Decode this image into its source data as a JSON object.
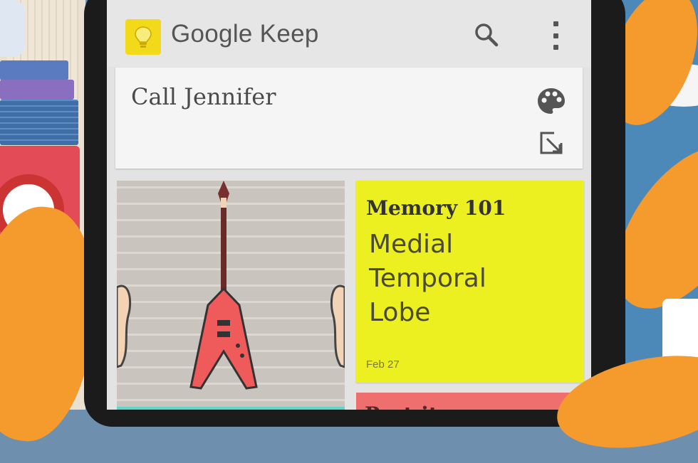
{
  "app": {
    "title": "Google Keep",
    "logo_icon": "lightbulb-icon",
    "search_icon": "search-icon",
    "menu_icon": "more-vert-icon"
  },
  "notes": [
    {
      "title": "Call Jennifer",
      "actions": [
        "palette-icon",
        "expand-icon"
      ],
      "color": "#f5f5f5"
    },
    {
      "type": "image",
      "image": "guitar-illustration",
      "color": "#5fd6c8"
    },
    {
      "title": "Memory 101",
      "lines": [
        "Medial",
        "Temporal",
        "Lobe"
      ],
      "date": "Feb 27",
      "color": "#edf020"
    },
    {
      "title": "Post-it",
      "color": "#ef6f6f"
    }
  ],
  "colors": {
    "accent_yellow": "#f2d91a",
    "app_bar": "#e6e6e6",
    "background_orange": "#f59a2c"
  }
}
